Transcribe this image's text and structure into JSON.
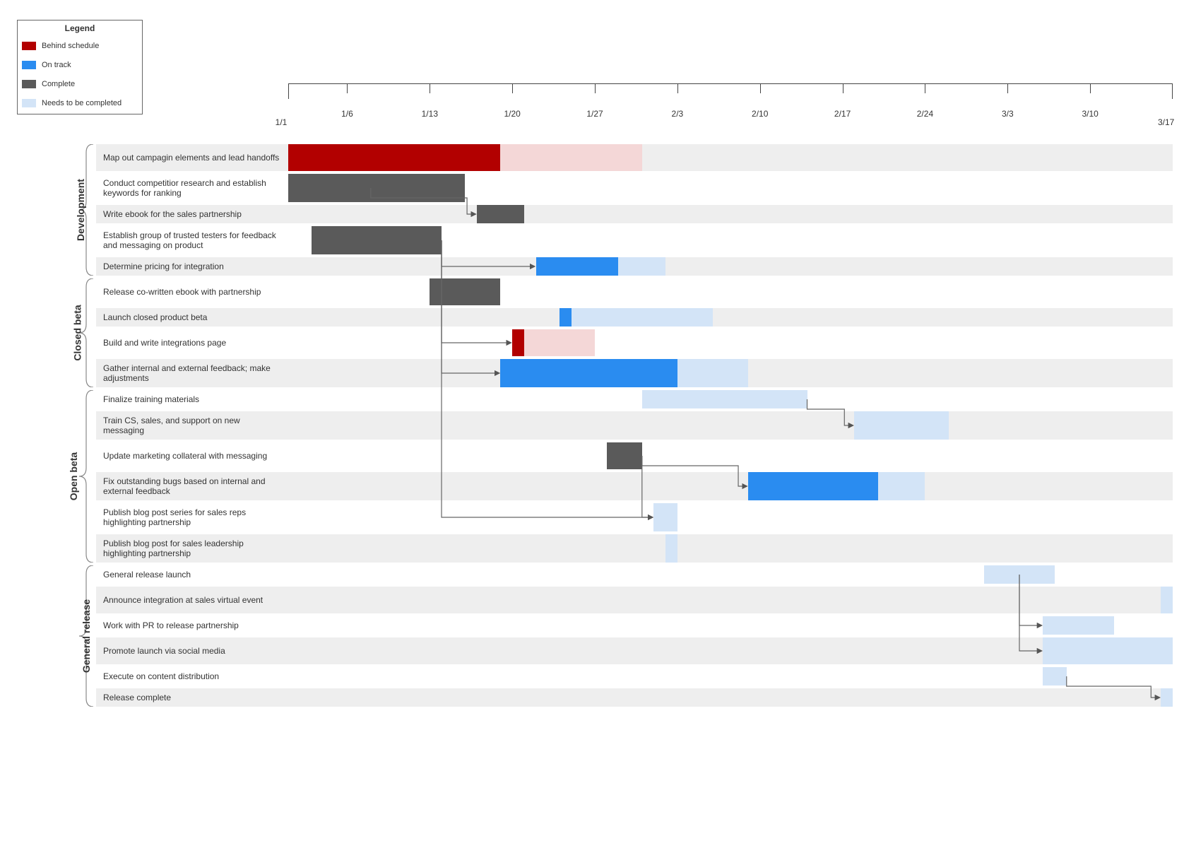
{
  "legend": {
    "title": "Legend",
    "items": [
      {
        "label": "Behind schedule",
        "color": "#b20000"
      },
      {
        "label": "On track",
        "color": "#2a8cf0"
      },
      {
        "label": "Complete",
        "color": "#5a5a5a"
      },
      {
        "label": "Needs to be completed",
        "color": "#d3e4f7"
      }
    ]
  },
  "colors": {
    "behind": "#b20000",
    "behind_light": "#f4d7d7",
    "track": "#2a8cf0",
    "complete": "#5a5a5a",
    "needs": "#d3e4f7"
  },
  "axis": {
    "start": "1/1",
    "end": "3/17",
    "start_day": 1,
    "end_day": 76,
    "ticks": [
      {
        "label": "1/6",
        "day": 6
      },
      {
        "label": "1/13",
        "day": 13
      },
      {
        "label": "1/20",
        "day": 20
      },
      {
        "label": "1/27",
        "day": 27
      },
      {
        "label": "2/3",
        "day": 34
      },
      {
        "label": "2/10",
        "day": 41
      },
      {
        "label": "2/17",
        "day": 48
      },
      {
        "label": "2/24",
        "day": 55
      },
      {
        "label": "3/3",
        "day": 62
      },
      {
        "label": "3/10",
        "day": 69
      }
    ]
  },
  "groups": [
    {
      "name": "Development",
      "rows": [
        {
          "label": "Map out campagin elements and lead handoffs",
          "tall": true,
          "bars": [
            [
              "behind",
              1,
              19
            ],
            [
              "behind_light",
              19,
              31
            ]
          ]
        },
        {
          "label": "Conduct competitior research and establish keywords for ranking",
          "tall": true,
          "bars": [
            [
              "complete",
              1,
              16
            ]
          ]
        },
        {
          "label": "Write ebook for the sales partnership",
          "bars": [
            [
              "complete",
              17,
              21
            ]
          ]
        },
        {
          "label": "Establish group of trusted testers for feedback and messaging on product",
          "tall": true,
          "bars": [
            [
              "complete",
              3,
              14
            ]
          ]
        },
        {
          "label": "Determine pricing for integration",
          "bars": [
            [
              "track",
              22,
              29
            ],
            [
              "needs",
              29,
              33
            ]
          ]
        }
      ]
    },
    {
      "name": "Closed beta",
      "rows": [
        {
          "label": "Release co-written ebook with partnership",
          "tall": true,
          "bars": [
            [
              "complete",
              13,
              19
            ]
          ]
        },
        {
          "label": "Launch closed product beta",
          "bars": [
            [
              "track",
              24,
              25
            ],
            [
              "needs",
              25,
              37
            ]
          ]
        },
        {
          "label": "Build and write integrations page",
          "tall": true,
          "bars": [
            [
              "behind",
              20,
              21
            ],
            [
              "behind_light",
              21,
              27
            ]
          ]
        },
        {
          "label": "Gather internal and external feedback; make adjustments",
          "tall": true,
          "bars": [
            [
              "track",
              19,
              34
            ],
            [
              "needs",
              34,
              40
            ]
          ]
        }
      ]
    },
    {
      "name": "Open beta",
      "rows": [
        {
          "label": "Finalize training materials",
          "bars": [
            [
              "needs",
              31,
              45
            ]
          ]
        },
        {
          "label": "Train CS, sales, and support on new messaging",
          "tall": true,
          "bars": [
            [
              "needs",
              49,
              57
            ]
          ]
        },
        {
          "label": "Update marketing collateral with messaging",
          "tall": true,
          "bars": [
            [
              "complete",
              28,
              31
            ]
          ]
        },
        {
          "label": "Fix outstanding bugs based on internal and external feedback",
          "tall": true,
          "bars": [
            [
              "track",
              40,
              51
            ],
            [
              "needs",
              51,
              55
            ]
          ]
        },
        {
          "label": "Publish blog post series for sales reps highlighting partnership",
          "tall": true,
          "bars": [
            [
              "needs",
              32,
              34
            ]
          ]
        },
        {
          "label": "Publish blog post for sales leadership highlighting partnership",
          "tall": true,
          "bars": [
            [
              "needs",
              33,
              34
            ]
          ]
        }
      ]
    },
    {
      "name": "General release",
      "rows": [
        {
          "label": "General release launch",
          "bars": [
            [
              "needs",
              60,
              66
            ]
          ]
        },
        {
          "label": "Announce integration at sales virtual event",
          "tall": true,
          "bars": [
            [
              "needs",
              75,
              76
            ]
          ]
        },
        {
          "label": "Work with PR to release partnership",
          "bars": [
            [
              "needs",
              65,
              71
            ]
          ]
        },
        {
          "label": "Promote launch via social media",
          "tall": true,
          "bars": [
            [
              "needs",
              65,
              76
            ]
          ]
        },
        {
          "label": "Execute on content distribution",
          "bars": [
            [
              "needs",
              65,
              67
            ]
          ]
        },
        {
          "label": "Release complete",
          "bars": [
            [
              "needs",
              75,
              76
            ]
          ]
        }
      ]
    }
  ],
  "chart_data": {
    "type": "gantt",
    "title": "",
    "x_start": "1/1",
    "x_end": "3/17",
    "x_ticks": [
      "1/6",
      "1/13",
      "1/20",
      "1/27",
      "2/3",
      "2/10",
      "2/17",
      "2/24",
      "3/3",
      "3/10"
    ],
    "status_legend": {
      "behind": "Behind schedule",
      "track": "On track",
      "complete": "Complete",
      "needs": "Needs to be completed"
    },
    "phases": [
      {
        "name": "Development",
        "tasks": [
          {
            "name": "Map out campagin elements and lead handoffs",
            "start": "1/1",
            "end": "1/31",
            "segments": [
              {
                "status": "behind",
                "start": "1/1",
                "end": "1/19"
              },
              {
                "status": "behind_remaining",
                "start": "1/19",
                "end": "1/31"
              }
            ]
          },
          {
            "name": "Conduct competitior research and establish keywords for ranking",
            "start": "1/1",
            "end": "1/16",
            "status": "complete"
          },
          {
            "name": "Write ebook for the sales partnership",
            "start": "1/17",
            "end": "1/21",
            "status": "complete",
            "depends_on": [
              "Conduct competitior research and establish keywords for ranking"
            ]
          },
          {
            "name": "Establish group of trusted testers for feedback and messaging on product",
            "start": "1/3",
            "end": "1/14",
            "status": "complete"
          },
          {
            "name": "Determine pricing for integration",
            "start": "1/22",
            "end": "2/2",
            "segments": [
              {
                "status": "track",
                "start": "1/22",
                "end": "1/29"
              },
              {
                "status": "needs",
                "start": "1/29",
                "end": "2/2"
              }
            ],
            "depends_on": [
              "Establish group of trusted testers for feedback and messaging on product"
            ]
          }
        ]
      },
      {
        "name": "Closed beta",
        "tasks": [
          {
            "name": "Release co-written ebook with partnership",
            "start": "1/13",
            "end": "1/19",
            "status": "complete"
          },
          {
            "name": "Launch closed product beta",
            "start": "1/24",
            "end": "2/6",
            "segments": [
              {
                "status": "track",
                "start": "1/24",
                "end": "1/25"
              },
              {
                "status": "needs",
                "start": "1/25",
                "end": "2/6"
              }
            ]
          },
          {
            "name": "Build and write integrations page",
            "start": "1/20",
            "end": "1/27",
            "segments": [
              {
                "status": "behind",
                "start": "1/20",
                "end": "1/21"
              },
              {
                "status": "behind_remaining",
                "start": "1/21",
                "end": "1/27"
              }
            ],
            "depends_on": [
              "Establish group of trusted testers for feedback and messaging on product"
            ]
          },
          {
            "name": "Gather internal and external feedback; make adjustments",
            "start": "1/19",
            "end": "2/9",
            "segments": [
              {
                "status": "track",
                "start": "1/19",
                "end": "2/3"
              },
              {
                "status": "needs",
                "start": "2/3",
                "end": "2/9"
              }
            ],
            "depends_on": [
              "Establish group of trusted testers for feedback and messaging on product"
            ]
          }
        ]
      },
      {
        "name": "Open beta",
        "tasks": [
          {
            "name": "Finalize training materials",
            "start": "1/31",
            "end": "2/14",
            "status": "needs"
          },
          {
            "name": "Train CS, sales, and support on new messaging",
            "start": "2/18",
            "end": "2/26",
            "status": "needs",
            "depends_on": [
              "Finalize training materials"
            ]
          },
          {
            "name": "Update marketing collateral with messaging",
            "start": "1/28",
            "end": "1/31",
            "status": "complete"
          },
          {
            "name": "Fix outstanding bugs based on internal and external feedback",
            "start": "2/9",
            "end": "2/24",
            "segments": [
              {
                "status": "track",
                "start": "2/9",
                "end": "2/20"
              },
              {
                "status": "needs",
                "start": "2/20",
                "end": "2/24"
              }
            ],
            "depends_on": [
              "Update marketing collateral with messaging"
            ]
          },
          {
            "name": "Publish blog post series for sales reps highlighting partnership",
            "start": "2/1",
            "end": "2/3",
            "status": "needs",
            "depends_on": [
              "Establish group of trusted testers for feedback and messaging on product",
              "Update marketing collateral with messaging"
            ]
          },
          {
            "name": "Publish blog post for sales leadership highlighting partnership",
            "start": "2/2",
            "end": "2/3",
            "status": "needs"
          }
        ]
      },
      {
        "name": "General release",
        "tasks": [
          {
            "name": "General release launch",
            "start": "3/1",
            "end": "3/7",
            "status": "needs"
          },
          {
            "name": "Announce integration at sales virtual event",
            "start": "3/16",
            "end": "3/17",
            "status": "needs"
          },
          {
            "name": "Work with PR to release partnership",
            "start": "3/6",
            "end": "3/12",
            "status": "needs",
            "depends_on": [
              "General release launch"
            ]
          },
          {
            "name": "Promote launch via social media",
            "start": "3/6",
            "end": "3/17",
            "status": "needs",
            "depends_on": [
              "General release launch"
            ]
          },
          {
            "name": "Execute on content distribution",
            "start": "3/6",
            "end": "3/8",
            "status": "needs"
          },
          {
            "name": "Release complete",
            "start": "3/16",
            "end": "3/17",
            "status": "needs",
            "depends_on": [
              "Execute on content distribution"
            ]
          }
        ]
      }
    ]
  }
}
